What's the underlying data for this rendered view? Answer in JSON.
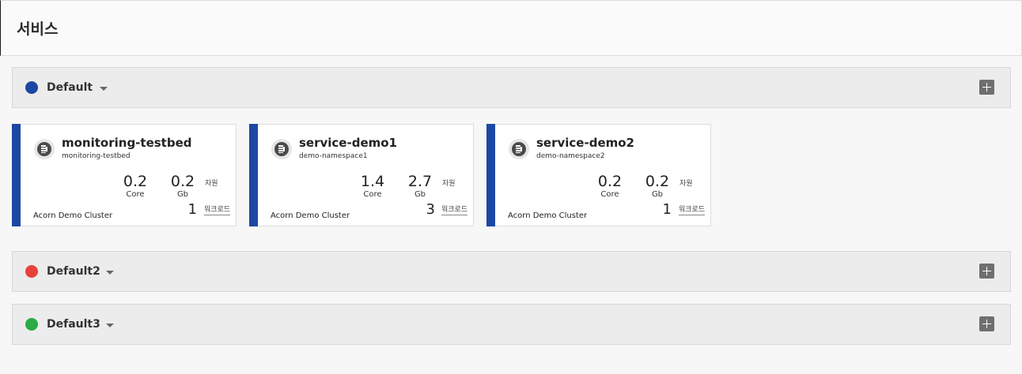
{
  "page": {
    "title": "서비스"
  },
  "groups": [
    {
      "name": "Default",
      "color": "#1c47a3"
    },
    {
      "name": "Default2",
      "color": "#e8413c"
    },
    {
      "name": "Default3",
      "color": "#2bab44"
    }
  ],
  "cards": [
    {
      "name": "monitoring-testbed",
      "namespace": "monitoring-testbed",
      "core": "0.2",
      "core_unit": "Core",
      "memory": "0.2",
      "memory_unit": "Gb",
      "resource_label": "자원",
      "workloads": "1",
      "workload_label": "워크로드",
      "cluster": "Acorn Demo Cluster"
    },
    {
      "name": "service-demo1",
      "namespace": "demo-namespace1",
      "core": "1.4",
      "core_unit": "Core",
      "memory": "2.7",
      "memory_unit": "Gb",
      "resource_label": "자원",
      "workloads": "3",
      "workload_label": "워크로드",
      "cluster": "Acorn Demo Cluster"
    },
    {
      "name": "service-demo2",
      "namespace": "demo-namespace2",
      "core": "0.2",
      "core_unit": "Core",
      "memory": "0.2",
      "memory_unit": "Gb",
      "resource_label": "자원",
      "workloads": "1",
      "workload_label": "워크로드",
      "cluster": "Acorn Demo Cluster"
    }
  ],
  "icons": {
    "service": "service-icon",
    "add": "plus-icon",
    "expand": "chevron-down-icon"
  },
  "colors": {
    "card_stripe": "#1c47a3",
    "group_bar": "#ececec",
    "add_button": "#6f6f6f"
  }
}
